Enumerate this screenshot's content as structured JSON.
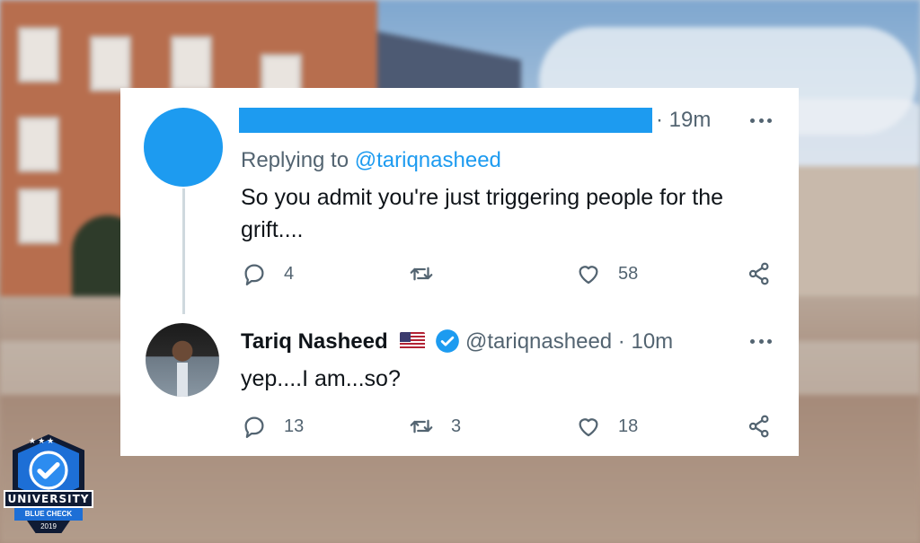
{
  "tweet1": {
    "time": "· 19m",
    "replying_prefix": "Replying to",
    "replying_handle": "@tariqnasheed",
    "text": "So you admit you're just triggering people for the grift....",
    "replies": "4",
    "retweets": "",
    "likes": "58"
  },
  "tweet2": {
    "name": "Tariq Nasheed",
    "handle_time": "@tariqnasheed · 10m",
    "text": "yep....I am...so?",
    "replies": "13",
    "retweets": "3",
    "likes": "18"
  },
  "badge": {
    "title": "UNIVERSITY",
    "subtitle": "BLUE CHECK",
    "year": "2019"
  },
  "colors": {
    "accent": "#1d9bf0",
    "muted": "#536471",
    "text": "#0f1419",
    "badge_navy": "#0f1b34",
    "badge_blue": "#1d6fd6"
  },
  "icons": {
    "reply": "speech-bubble-icon",
    "retweet": "retweet-icon",
    "like": "heart-icon",
    "share": "share-icon",
    "more": "more-dots-icon",
    "verified": "verified-check-icon",
    "flag": "us-flag-icon"
  }
}
